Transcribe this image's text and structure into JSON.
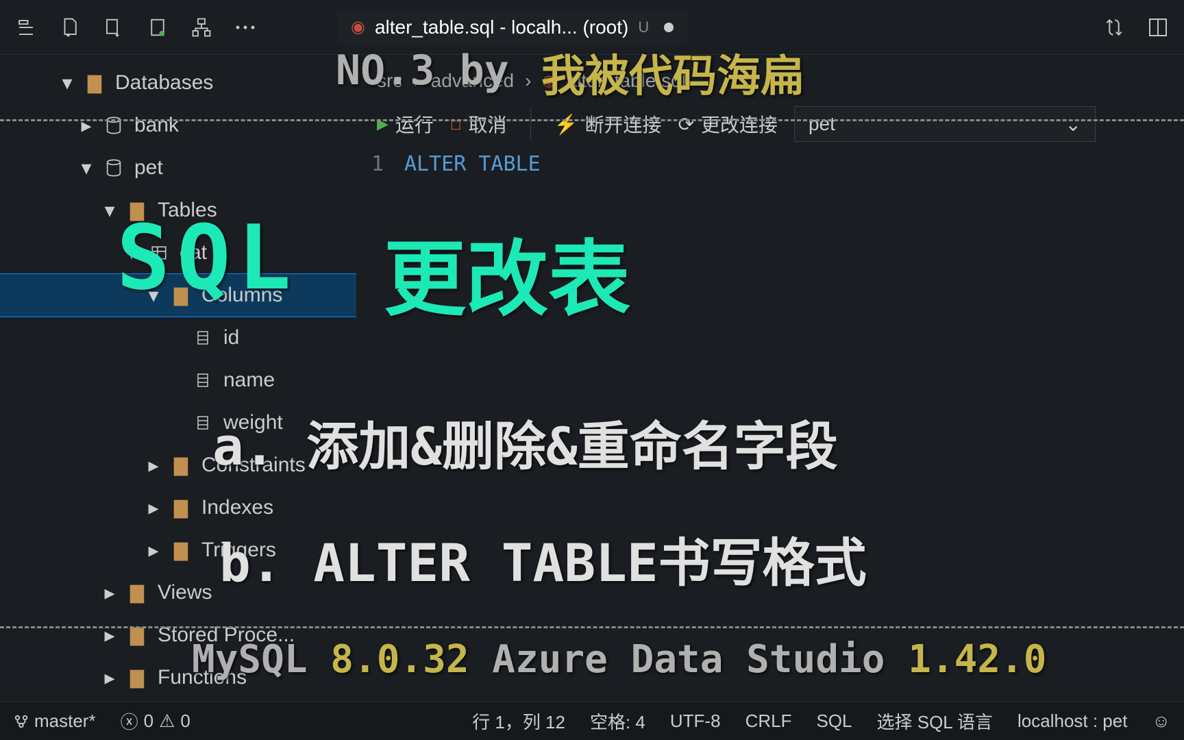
{
  "tab": {
    "title": "alter_table.sql - localh... (root)",
    "badge": "U"
  },
  "breadcrumb": {
    "p1": "src",
    "p2": "advanced",
    "file": "alter_table.sql"
  },
  "actions": {
    "run": "运行",
    "cancel": "取消",
    "disconnect": "断开连接",
    "change_conn": "更改连接",
    "db_select": "pet"
  },
  "code": {
    "line1_num": "1",
    "line1_text": "ALTER TABLE"
  },
  "tree": {
    "databases": "Databases",
    "bank": "bank",
    "pet": "pet",
    "tables": "Tables",
    "cat": "cat",
    "columns": "Columns",
    "cols": [
      "id",
      "name",
      "weight"
    ],
    "constraints": "Constraints",
    "indexes": "Indexes",
    "triggers": "Triggers",
    "views": "Views",
    "stored": "Stored Proce...",
    "functions": "Functions"
  },
  "status": {
    "branch": "master*",
    "err": "0",
    "warn": "0",
    "pos": "行 1，列 12",
    "spaces": "空格: 4",
    "enc": "UTF-8",
    "eol": "CRLF",
    "lang": "SQL",
    "sel_sql": "选择 SQL 语言",
    "conn": "localhost : pet"
  },
  "overlay": {
    "no3": "NO.3 by",
    "author": "我被代码海扁",
    "sql_big": "SQL",
    "title_big": "更改表",
    "line_a": "a. 添加&删除&重命名字段",
    "line_b": "b. ALTER TABLE书写格式",
    "mysql_pre": "MySQL ",
    "mysql_v": "8.0.32",
    "ads_pre": " Azure Data Studio ",
    "ads_v": "1.42.0"
  }
}
